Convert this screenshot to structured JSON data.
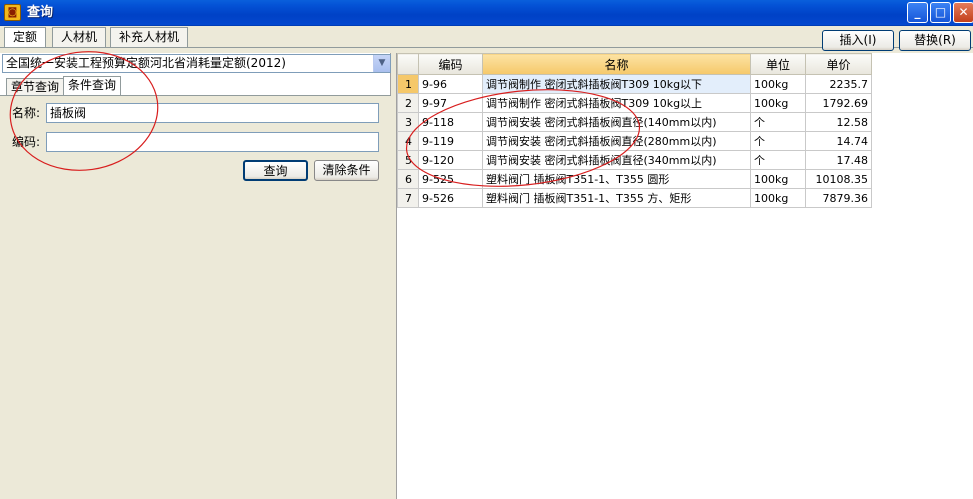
{
  "window": {
    "title": "查询",
    "app_icon_glyph": "◙",
    "min_glyph": "_",
    "max_glyph": "□",
    "close_glyph": "✕"
  },
  "top_tabs": [
    "定额",
    "人材机",
    "补充人材机"
  ],
  "actions": {
    "insert": "插入(I)",
    "replace": "替换(R)"
  },
  "left": {
    "quota_library": "全国统一安装工程预算定额河北省消耗量定额(2012)",
    "sub_tabs": [
      "章节查询",
      "条件查询"
    ],
    "name_label": "名称:",
    "name_value": "插板阀",
    "code_label": "编码:",
    "code_value": "",
    "query_button": "查询",
    "clear_button": "清除条件"
  },
  "grid": {
    "columns": [
      "",
      "编码",
      "名称",
      "单位",
      "单价"
    ],
    "rows": [
      {
        "no": "1",
        "code": "9-96",
        "name": "调节阀制作 密闭式斜插板阀T309 10kg以下",
        "unit": "100kg",
        "price": "2235.7"
      },
      {
        "no": "2",
        "code": "9-97",
        "name": "调节阀制作 密闭式斜插板阀T309 10kg以上",
        "unit": "100kg",
        "price": "1792.69"
      },
      {
        "no": "3",
        "code": "9-118",
        "name": "调节阀安装 密闭式斜插板阀直径(140mm以内)",
        "unit": "个",
        "price": "12.58"
      },
      {
        "no": "4",
        "code": "9-119",
        "name": "调节阀安装 密闭式斜插板阀直径(280mm以内)",
        "unit": "个",
        "price": "14.74"
      },
      {
        "no": "5",
        "code": "9-120",
        "name": "调节阀安装 密闭式斜插板阀直径(340mm以内)",
        "unit": "个",
        "price": "17.48"
      },
      {
        "no": "6",
        "code": "9-525",
        "name": "塑料阀门 插板阀T351-1、T355 圆形",
        "unit": "100kg",
        "price": "10108.35"
      },
      {
        "no": "7",
        "code": "9-526",
        "name": "塑料阀门 插板阀T351-1、T355 方、矩形",
        "unit": "100kg",
        "price": "7879.36"
      }
    ]
  },
  "colors": {
    "annotation": "#D81E1E",
    "titlebar": "#0453D6",
    "selected_header": "#F5C86A"
  }
}
